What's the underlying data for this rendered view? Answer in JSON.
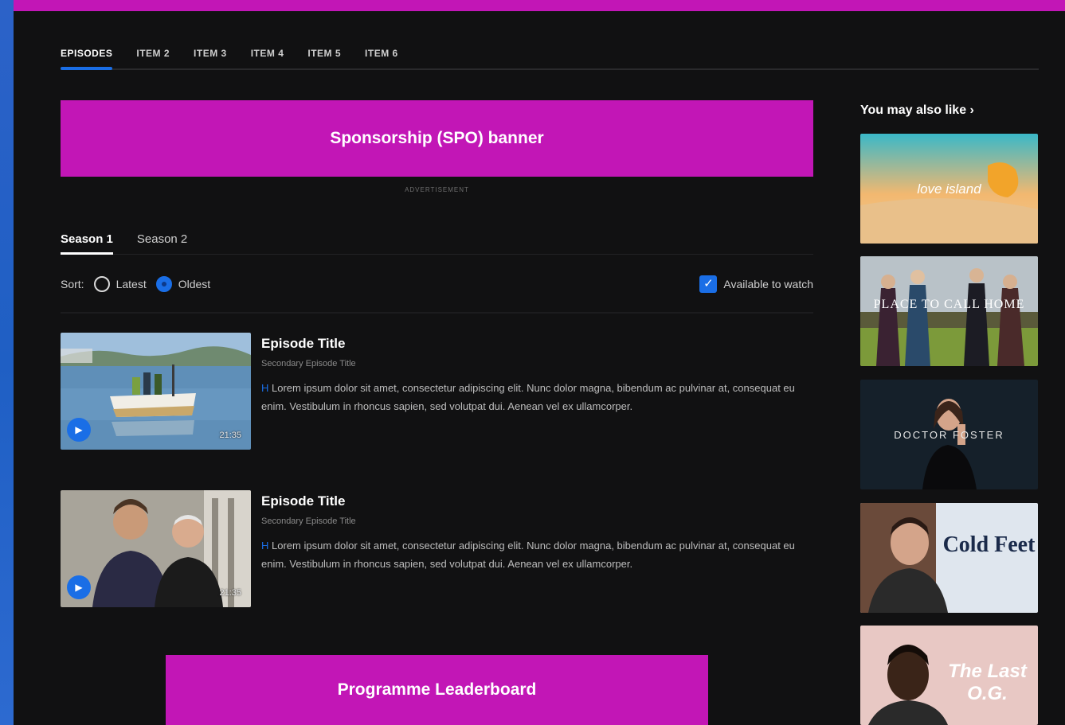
{
  "tabs": [
    {
      "label": "EPISODES"
    },
    {
      "label": "ITEM 2"
    },
    {
      "label": "ITEM 3"
    },
    {
      "label": "ITEM 4"
    },
    {
      "label": "ITEM 5"
    },
    {
      "label": "ITEM 6"
    }
  ],
  "spo_banner": {
    "label": "Sponsorship (SPO) banner",
    "ad_label": "ADVERTISEMENT"
  },
  "seasons": [
    {
      "label": "Season 1"
    },
    {
      "label": "Season 2"
    }
  ],
  "sort": {
    "label": "Sort:",
    "options": [
      {
        "label": "Latest",
        "selected": false
      },
      {
        "label": "Oldest",
        "selected": true
      }
    ],
    "available_label": "Available to watch",
    "available_checked": true
  },
  "episodes": [
    {
      "title": "Episode Title",
      "subtitle": "Secondary Episode Title",
      "tag": "H",
      "description": "Lorem ipsum dolor sit amet, consectetur adipiscing elit. Nunc dolor magna, bibendum ac pulvinar at, consequat eu enim. Vestibulum in rhoncus sapien, sed volutpat dui. Aenean vel ex ullamcorper.",
      "duration": "21:35"
    },
    {
      "title": "Episode Title",
      "subtitle": "Secondary Episode Title",
      "tag": "H",
      "description": "Lorem ipsum dolor sit amet, consectetur adipiscing elit. Nunc dolor magna, bibendum ac pulvinar at, consequat eu enim. Vestibulum in rhoncus sapien, sed volutpat dui. Aenean vel ex ullamcorper.",
      "duration": "21:35"
    }
  ],
  "leaderboard": {
    "label": "Programme Leaderboard"
  },
  "sidebar": {
    "heading": "You may also like ›",
    "recs": [
      {
        "label": "love island"
      },
      {
        "label": "PLACE TO CALL HOME"
      },
      {
        "label": "DOCTOR FOSTER"
      },
      {
        "label": "Cold Feet"
      },
      {
        "label": "The Last O.G."
      }
    ]
  },
  "colors": {
    "accent": "#1a6ee6",
    "ad_pink": "#c216b6",
    "background": "#111112"
  }
}
